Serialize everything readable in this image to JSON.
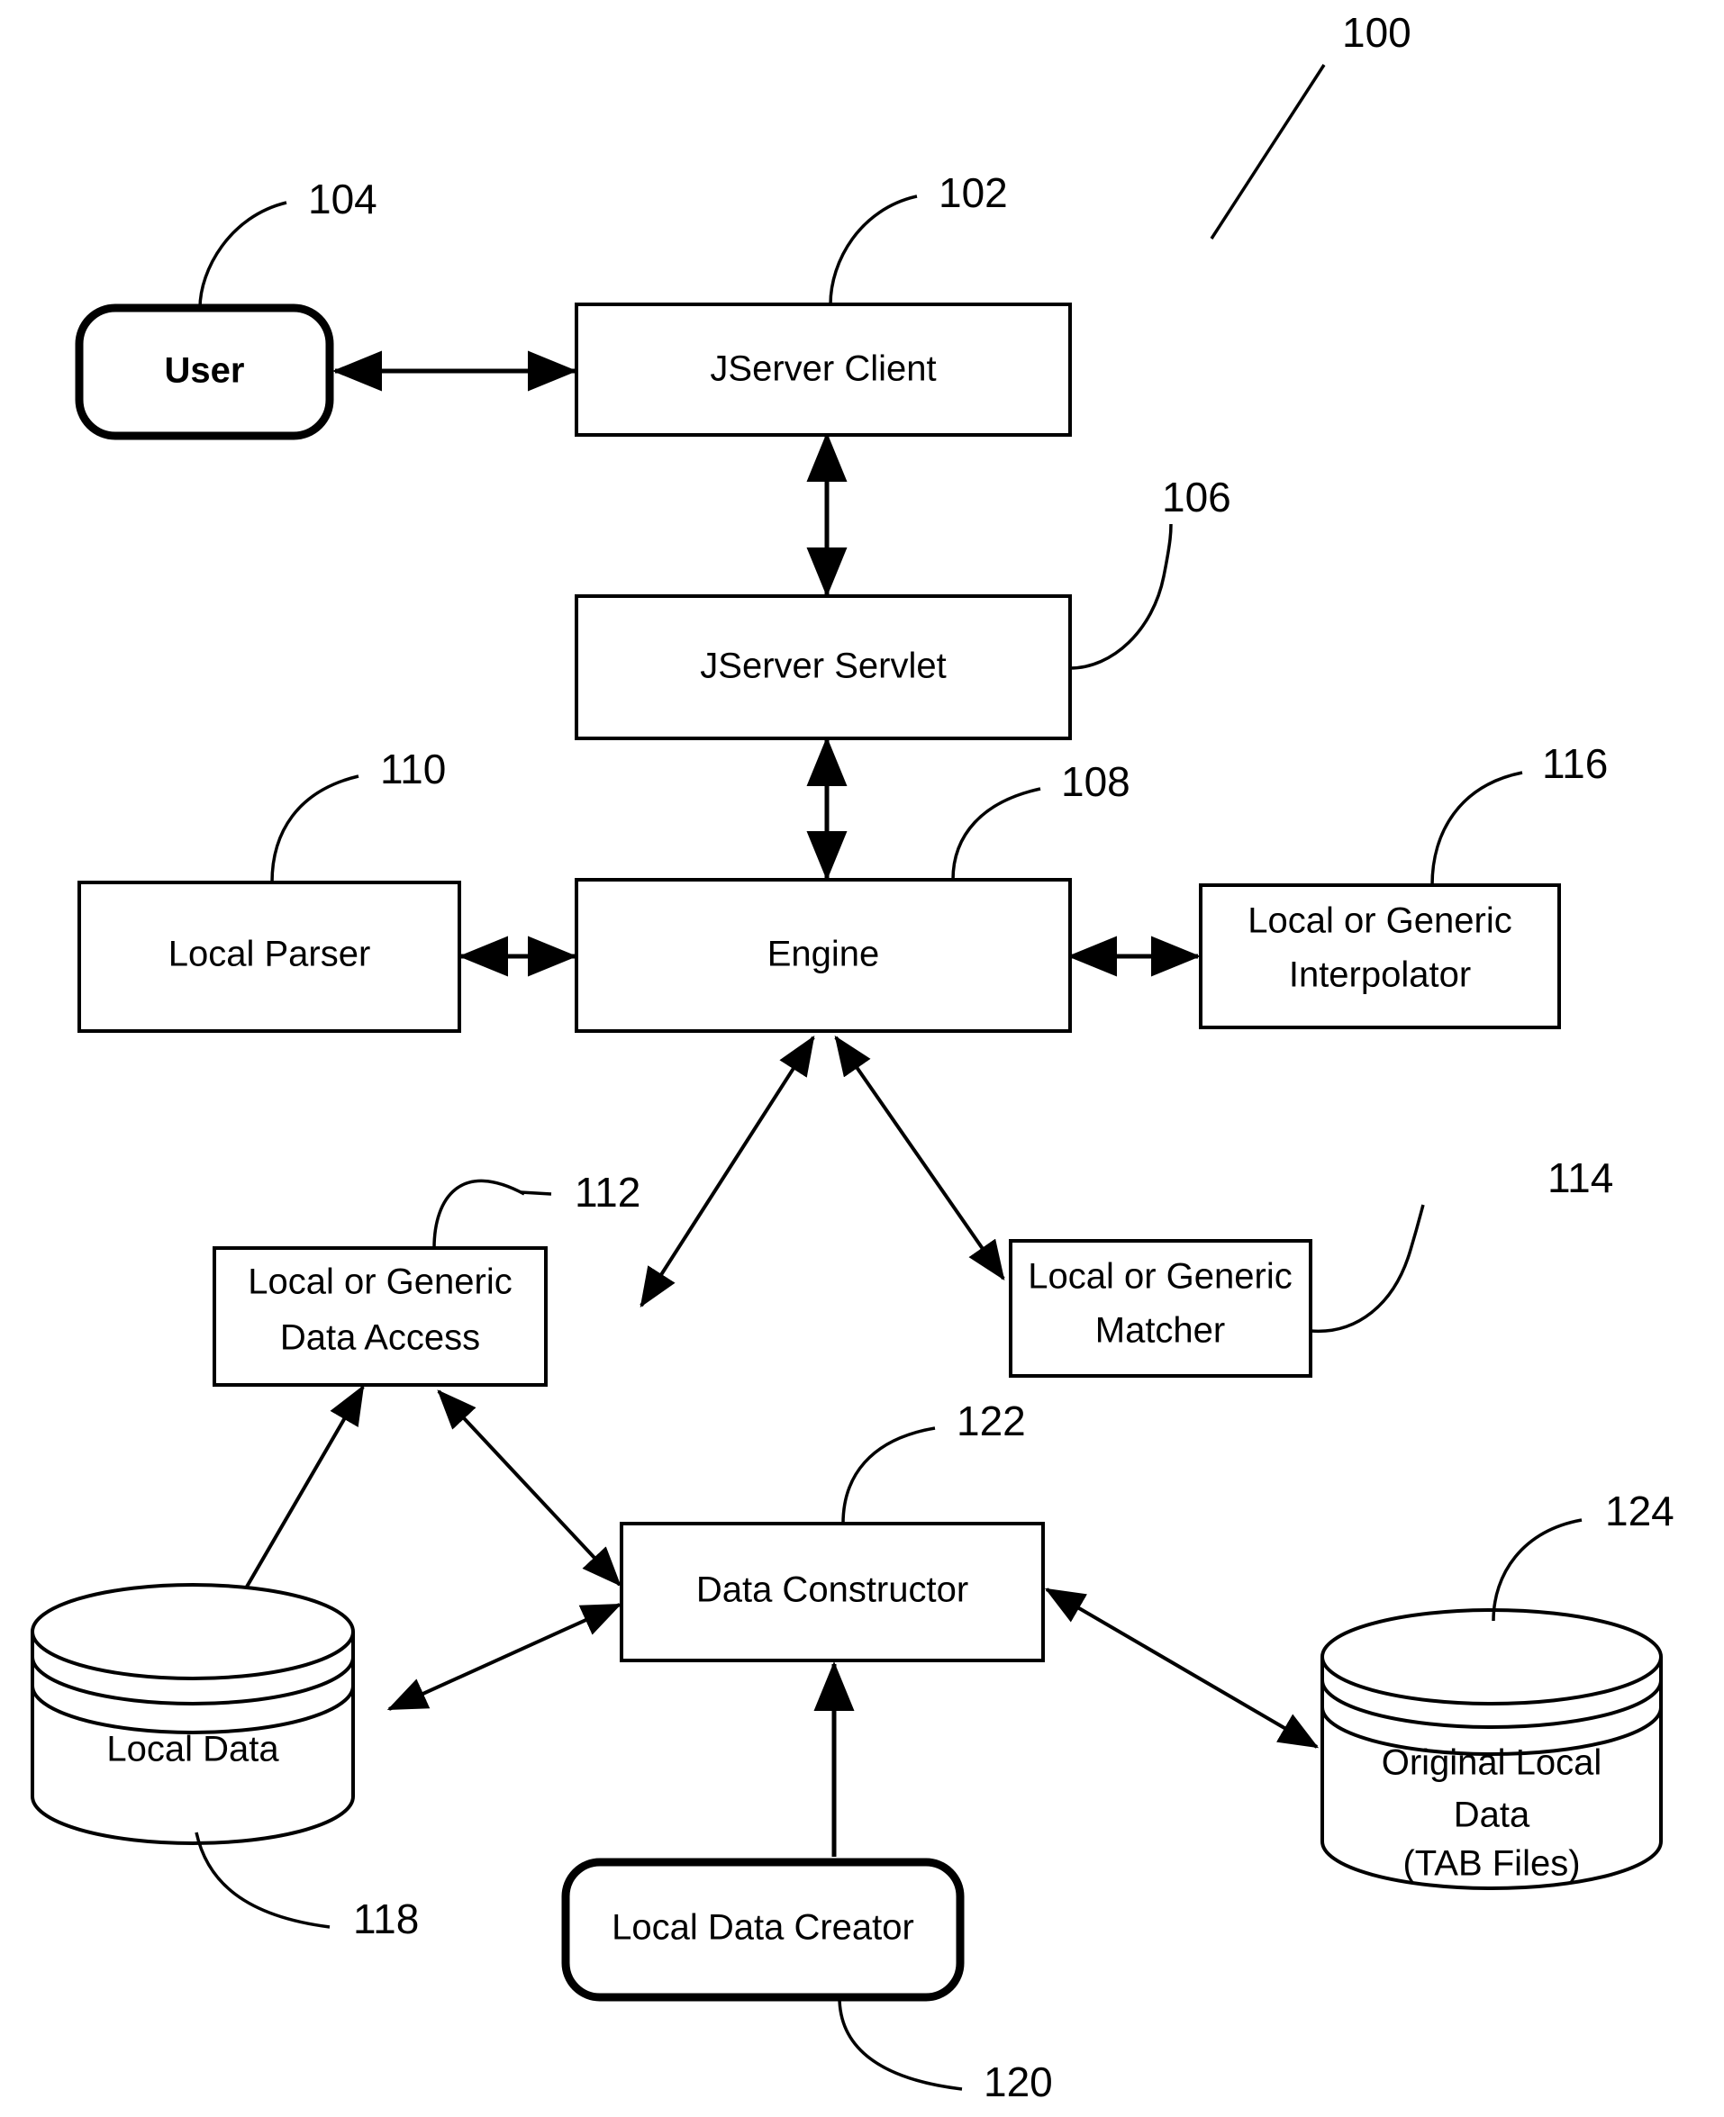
{
  "figure": {
    "reference_numeral": "100",
    "type": "patent-block-diagram"
  },
  "nodes": [
    {
      "id": "user",
      "label": "User",
      "ref": "104",
      "shape": "rounded-rect-bold"
    },
    {
      "id": "jserver_client",
      "label": "JServer Client",
      "ref": "102",
      "shape": "rect"
    },
    {
      "id": "jserver_servlet",
      "label": "JServer Servlet",
      "ref": "106",
      "shape": "rect"
    },
    {
      "id": "local_parser",
      "label": "Local Parser",
      "ref": "110",
      "shape": "rect"
    },
    {
      "id": "engine",
      "label": "Engine",
      "ref": "108",
      "shape": "rect"
    },
    {
      "id": "interpolator",
      "label_line1": "Local or Generic",
      "label_line2": "Interpolator",
      "ref": "116",
      "shape": "rect"
    },
    {
      "id": "data_access",
      "label_line1": "Local or Generic",
      "label_line2": "Data Access",
      "ref": "112",
      "shape": "rect"
    },
    {
      "id": "matcher",
      "label_line1": "Local or Generic",
      "label_line2": "Matcher",
      "ref": "114",
      "shape": "rect"
    },
    {
      "id": "data_constructor",
      "label": "Data Constructor",
      "ref": "122",
      "shape": "rect"
    },
    {
      "id": "local_data",
      "label": "Local Data",
      "ref": "118",
      "shape": "cylinder"
    },
    {
      "id": "original_local_data",
      "label_line1": "Original Local",
      "label_line2": "Data",
      "label_line3": "(TAB Files)",
      "ref": "124",
      "shape": "cylinder"
    },
    {
      "id": "local_data_creator",
      "label": "Local Data Creator",
      "ref": "120",
      "shape": "rounded-rect-bold"
    }
  ],
  "connections": [
    {
      "from": "user",
      "to": "jserver_client",
      "arrow": "both"
    },
    {
      "from": "jserver_client",
      "to": "jserver_servlet",
      "arrow": "both"
    },
    {
      "from": "jserver_servlet",
      "to": "engine",
      "arrow": "both"
    },
    {
      "from": "local_parser",
      "to": "engine",
      "arrow": "both"
    },
    {
      "from": "engine",
      "to": "interpolator",
      "arrow": "both"
    },
    {
      "from": "engine",
      "to": "data_access",
      "arrow": "both"
    },
    {
      "from": "engine",
      "to": "matcher",
      "arrow": "both"
    },
    {
      "from": "data_access",
      "to": "local_data",
      "arrow": "both"
    },
    {
      "from": "data_constructor",
      "to": "data_access",
      "arrow": "both"
    },
    {
      "from": "data_constructor",
      "to": "local_data",
      "arrow": "both"
    },
    {
      "from": "data_constructor",
      "to": "original_local_data",
      "arrow": "both"
    },
    {
      "from": "local_data_creator",
      "to": "data_constructor",
      "arrow": "single"
    }
  ],
  "colors": {
    "stroke": "#000000",
    "fill": "#ffffff",
    "background": "#ffffff"
  }
}
